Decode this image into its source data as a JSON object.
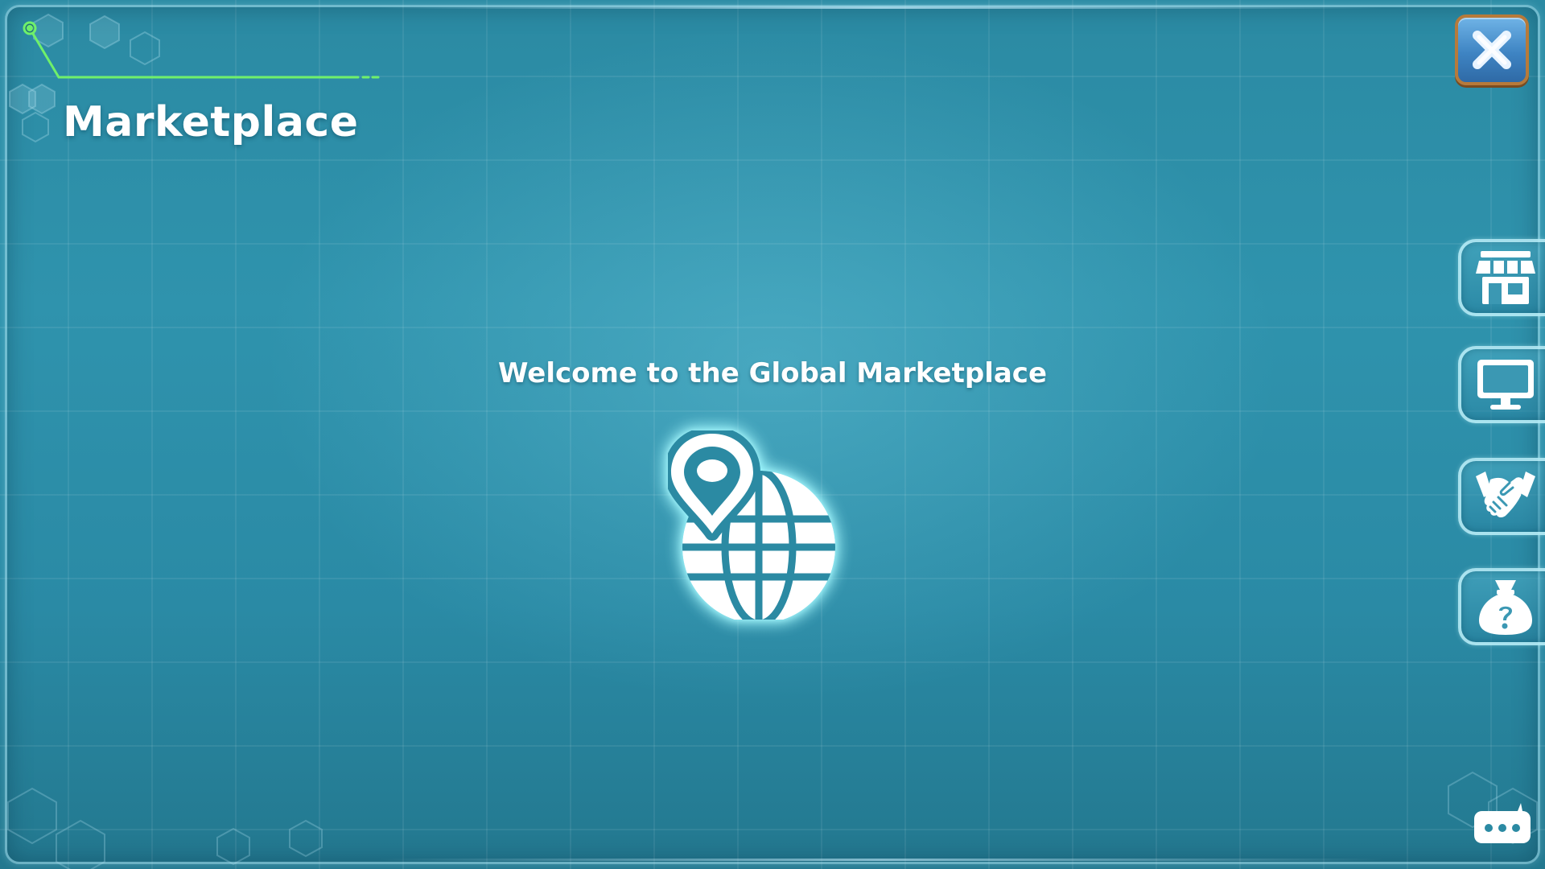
{
  "header": {
    "title": "Marketplace"
  },
  "main": {
    "welcome_text": "Welcome to the Global Marketplace",
    "center_icon": "globe-location-pin-icon"
  },
  "sidebar": {
    "buttons": [
      {
        "name": "shop",
        "icon": "storefront-icon"
      },
      {
        "name": "computer",
        "icon": "monitor-icon"
      },
      {
        "name": "trade",
        "icon": "handshake-icon"
      },
      {
        "name": "mystery",
        "icon": "mystery-bag-icon"
      }
    ]
  },
  "controls": {
    "close_icon": "close-icon",
    "chat_icon": "chat-bubble-icon"
  },
  "colors": {
    "background": "#2b8aa3",
    "accent_green": "#6ff06a",
    "close_button": "#3e84c3",
    "close_border": "#b77a3a",
    "icon_white": "#ffffff"
  }
}
